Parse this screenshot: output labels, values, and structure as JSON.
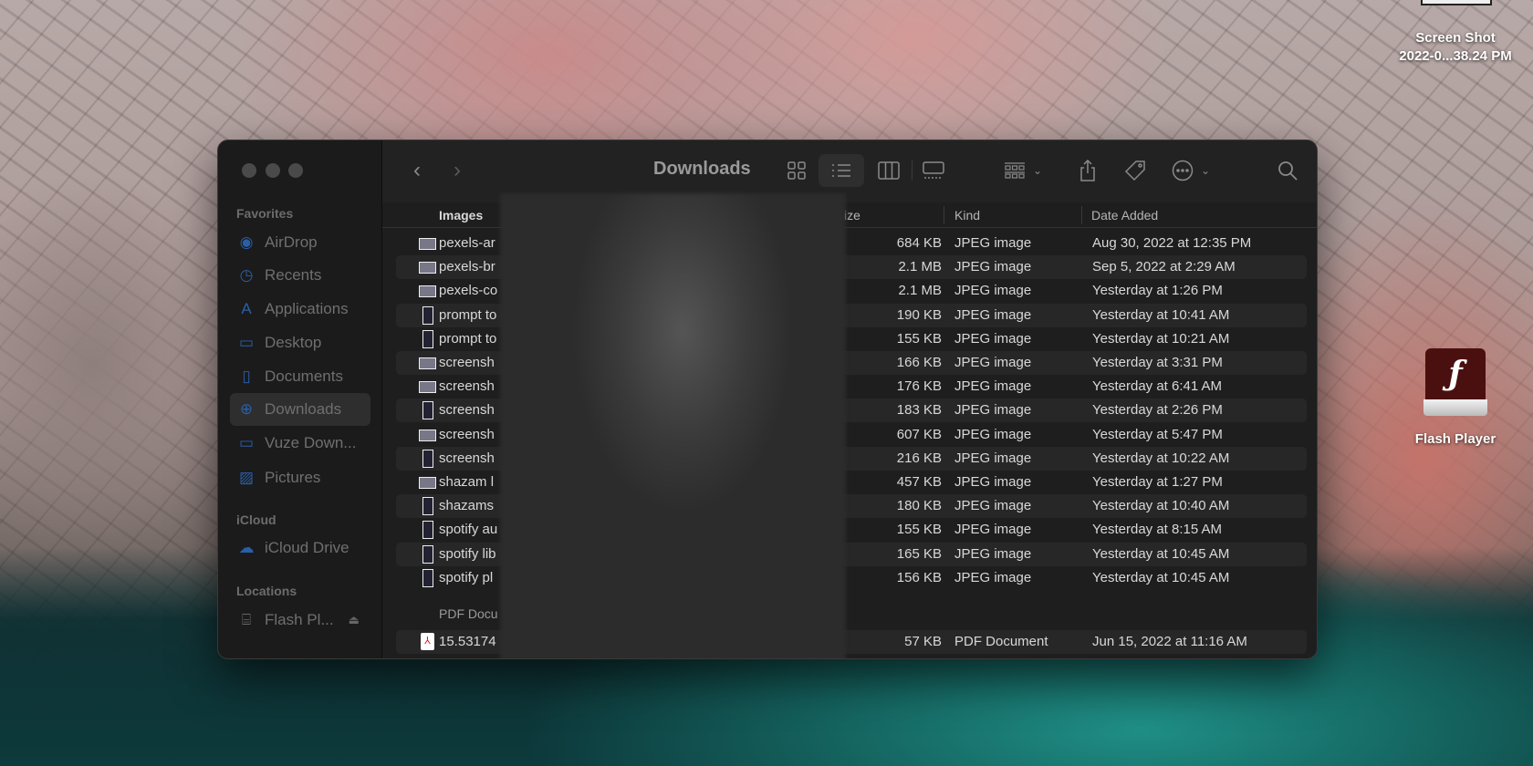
{
  "desktop": {
    "screenshot_icon": {
      "line1": "Screen Shot",
      "line2": "2022-0...38.24 PM"
    },
    "flash_icon": {
      "label": "Flash Player"
    }
  },
  "finder": {
    "title": "Downloads",
    "sidebar": {
      "favorites_label": "Favorites",
      "favorites": [
        {
          "label": "AirDrop",
          "icon": "airdrop-icon"
        },
        {
          "label": "Recents",
          "icon": "clock-icon"
        },
        {
          "label": "Applications",
          "icon": "applications-icon"
        },
        {
          "label": "Desktop",
          "icon": "desktop-icon"
        },
        {
          "label": "Documents",
          "icon": "document-icon"
        },
        {
          "label": "Downloads",
          "icon": "download-icon",
          "selected": true
        },
        {
          "label": "Vuze Down...",
          "icon": "folder-icon"
        },
        {
          "label": "Pictures",
          "icon": "pictures-icon"
        }
      ],
      "icloud_label": "iCloud",
      "icloud": [
        {
          "label": "iCloud Drive",
          "icon": "cloud-icon"
        }
      ],
      "locations_label": "Locations",
      "locations": [
        {
          "label": "Flash Pl...",
          "icon": "drive-icon"
        }
      ]
    },
    "columns": {
      "name": "Images",
      "size": "ize",
      "kind": "Kind",
      "date": "Date Added"
    },
    "images": [
      {
        "name": "pexels-ar",
        "size": "684 KB",
        "kind": "JPEG image",
        "date": "Aug 30, 2022 at 12:35 PM",
        "thumb": "landscape"
      },
      {
        "name": "pexels-br",
        "size": "2.1 MB",
        "kind": "JPEG image",
        "date": "Sep 5, 2022 at 2:29 AM",
        "thumb": "landscape"
      },
      {
        "name": "pexels-co",
        "size": "2.1 MB",
        "kind": "JPEG image",
        "date": "Yesterday at 1:26 PM",
        "thumb": "landscape"
      },
      {
        "name": "prompt to",
        "size": "190 KB",
        "kind": "JPEG image",
        "date": "Yesterday at 10:41 AM",
        "thumb": "portrait"
      },
      {
        "name": "prompt to",
        "size": "155 KB",
        "kind": "JPEG image",
        "date": "Yesterday at 10:21 AM",
        "thumb": "portrait"
      },
      {
        "name": "screensh",
        "size": "166 KB",
        "kind": "JPEG image",
        "date": "Yesterday at 3:31 PM",
        "thumb": "landscape"
      },
      {
        "name": "screensh",
        "size": "176 KB",
        "kind": "JPEG image",
        "date": "Yesterday at 6:41 AM",
        "thumb": "landscape"
      },
      {
        "name": "screensh",
        "size": "183 KB",
        "kind": "JPEG image",
        "date": "Yesterday at 2:26 PM",
        "thumb": "portrait"
      },
      {
        "name": "screensh",
        "size": "607 KB",
        "kind": "JPEG image",
        "date": "Yesterday at 5:47 PM",
        "thumb": "landscape"
      },
      {
        "name": "screensh",
        "size": "216 KB",
        "kind": "JPEG image",
        "date": "Yesterday at 10:22 AM",
        "thumb": "portrait"
      },
      {
        "name": "shazam l",
        "size": "457 KB",
        "kind": "JPEG image",
        "date": "Yesterday at 1:27 PM",
        "thumb": "landscape"
      },
      {
        "name": "shazams",
        "size": "180 KB",
        "kind": "JPEG image",
        "date": "Yesterday at 10:40 AM",
        "thumb": "portrait"
      },
      {
        "name": "spotify au",
        "size": "155 KB",
        "kind": "JPEG image",
        "date": "Yesterday at 8:15 AM",
        "thumb": "portrait"
      },
      {
        "name": "spotify lib",
        "size": "165 KB",
        "kind": "JPEG image",
        "date": "Yesterday at 10:45 AM",
        "thumb": "portrait"
      },
      {
        "name": "spotify pl",
        "size": "156 KB",
        "kind": "JPEG image",
        "date": "Yesterday at 10:45 AM",
        "thumb": "portrait"
      }
    ],
    "pdf_group_label": "PDF Docu",
    "pdfs": [
      {
        "name": "15.53174",
        "size": "57 KB",
        "kind": "PDF Document",
        "date": "Jun 15, 2022 at 11:16 AM"
      }
    ]
  }
}
